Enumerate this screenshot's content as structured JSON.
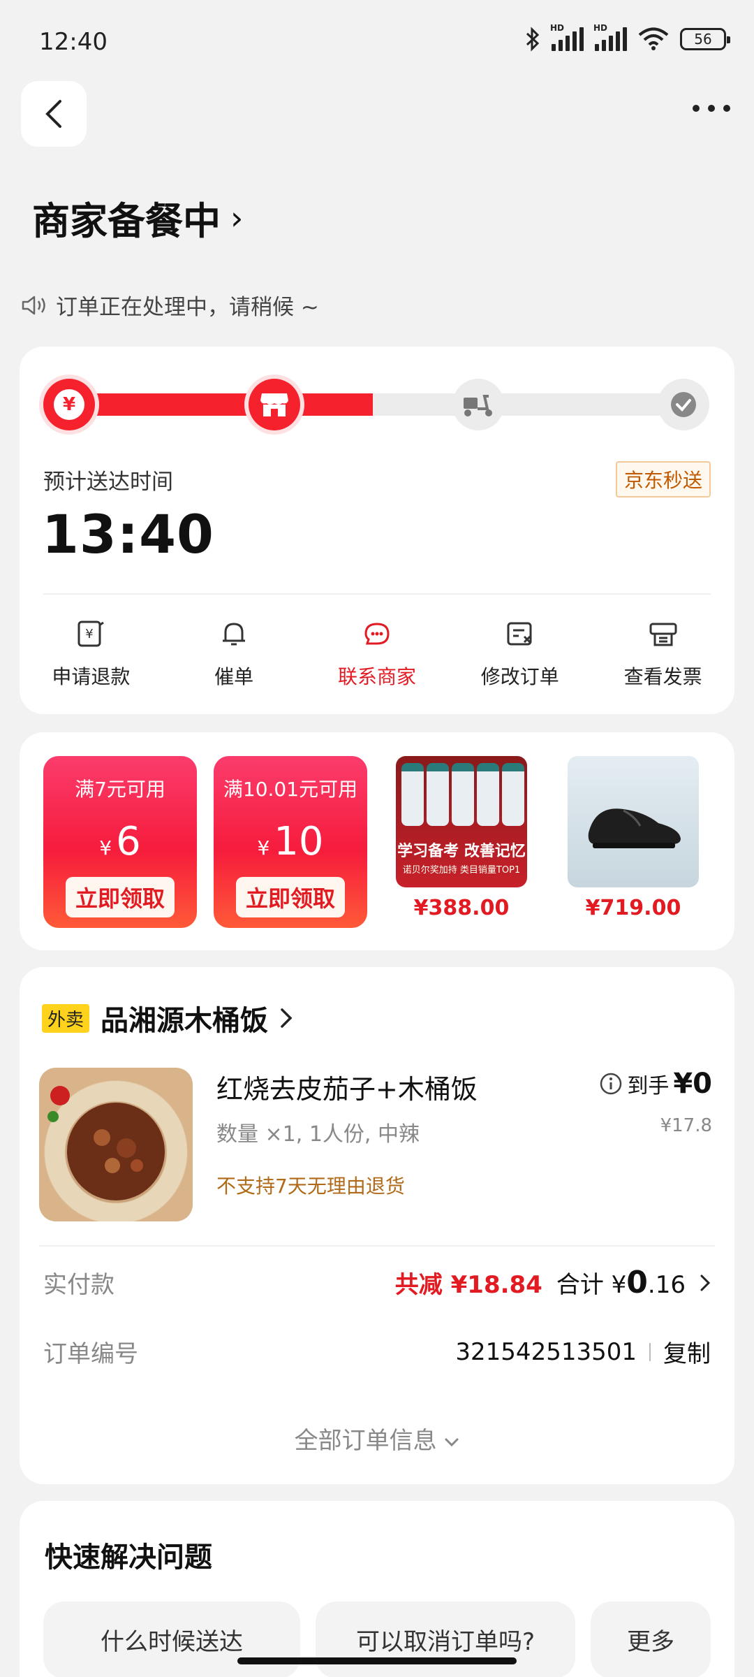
{
  "status_bar": {
    "time": "12:40",
    "battery": "56",
    "hd1": "HD",
    "hd2": "HD"
  },
  "header": {
    "title": "商家备餐中",
    "chevron": "›"
  },
  "notice": "订单正在处理中，请稍候 ~",
  "progress": {
    "fraction": 0.4,
    "steps": [
      "payment-icon",
      "store-icon",
      "scooter-icon",
      "check-icon"
    ]
  },
  "delivery": {
    "eta_label": "预计送达时间",
    "eta_time": "13:40",
    "badge": "京东秒送"
  },
  "actions": [
    {
      "label": "申请退款"
    },
    {
      "label": "催单"
    },
    {
      "label": "联系商家"
    },
    {
      "label": "修改订单"
    },
    {
      "label": "查看发票"
    }
  ],
  "promo": {
    "coupons": [
      {
        "condition": "满7元可用",
        "currency": "¥",
        "amount": "6",
        "button": "立即领取"
      },
      {
        "condition": "满10.01元可用",
        "currency": "¥",
        "amount": "10",
        "button": "立即领取"
      }
    ],
    "products": [
      {
        "price": "¥388.00",
        "img_text1": "学习备考 改善记忆",
        "img_text2": "诺贝尔奖加持 类目销量TOP1"
      },
      {
        "price": "¥719.00"
      }
    ]
  },
  "order": {
    "tag": "外卖",
    "store_name": "品湘源木桶饭",
    "dish_name": "红烧去皮茄子+木桶饭",
    "dish_meta": "数量 ×1, 1人份, 中辣",
    "dish_note": "不支持7天无理由退货",
    "received_label": "到手",
    "received_price": "¥0",
    "original_price": "¥17.8",
    "paid_label": "实付款",
    "discount": "共减 ¥18.84",
    "total_label": "合计 ¥",
    "total_int": "0",
    "total_dec": ".16",
    "order_no_label": "订单编号",
    "order_no": "321542513501",
    "copy": "复制",
    "all_info": "全部订单信息"
  },
  "faq": {
    "title": "快速解决问题",
    "chips": [
      "什么时候送达",
      "可以取消订单吗?",
      "更多"
    ]
  }
}
